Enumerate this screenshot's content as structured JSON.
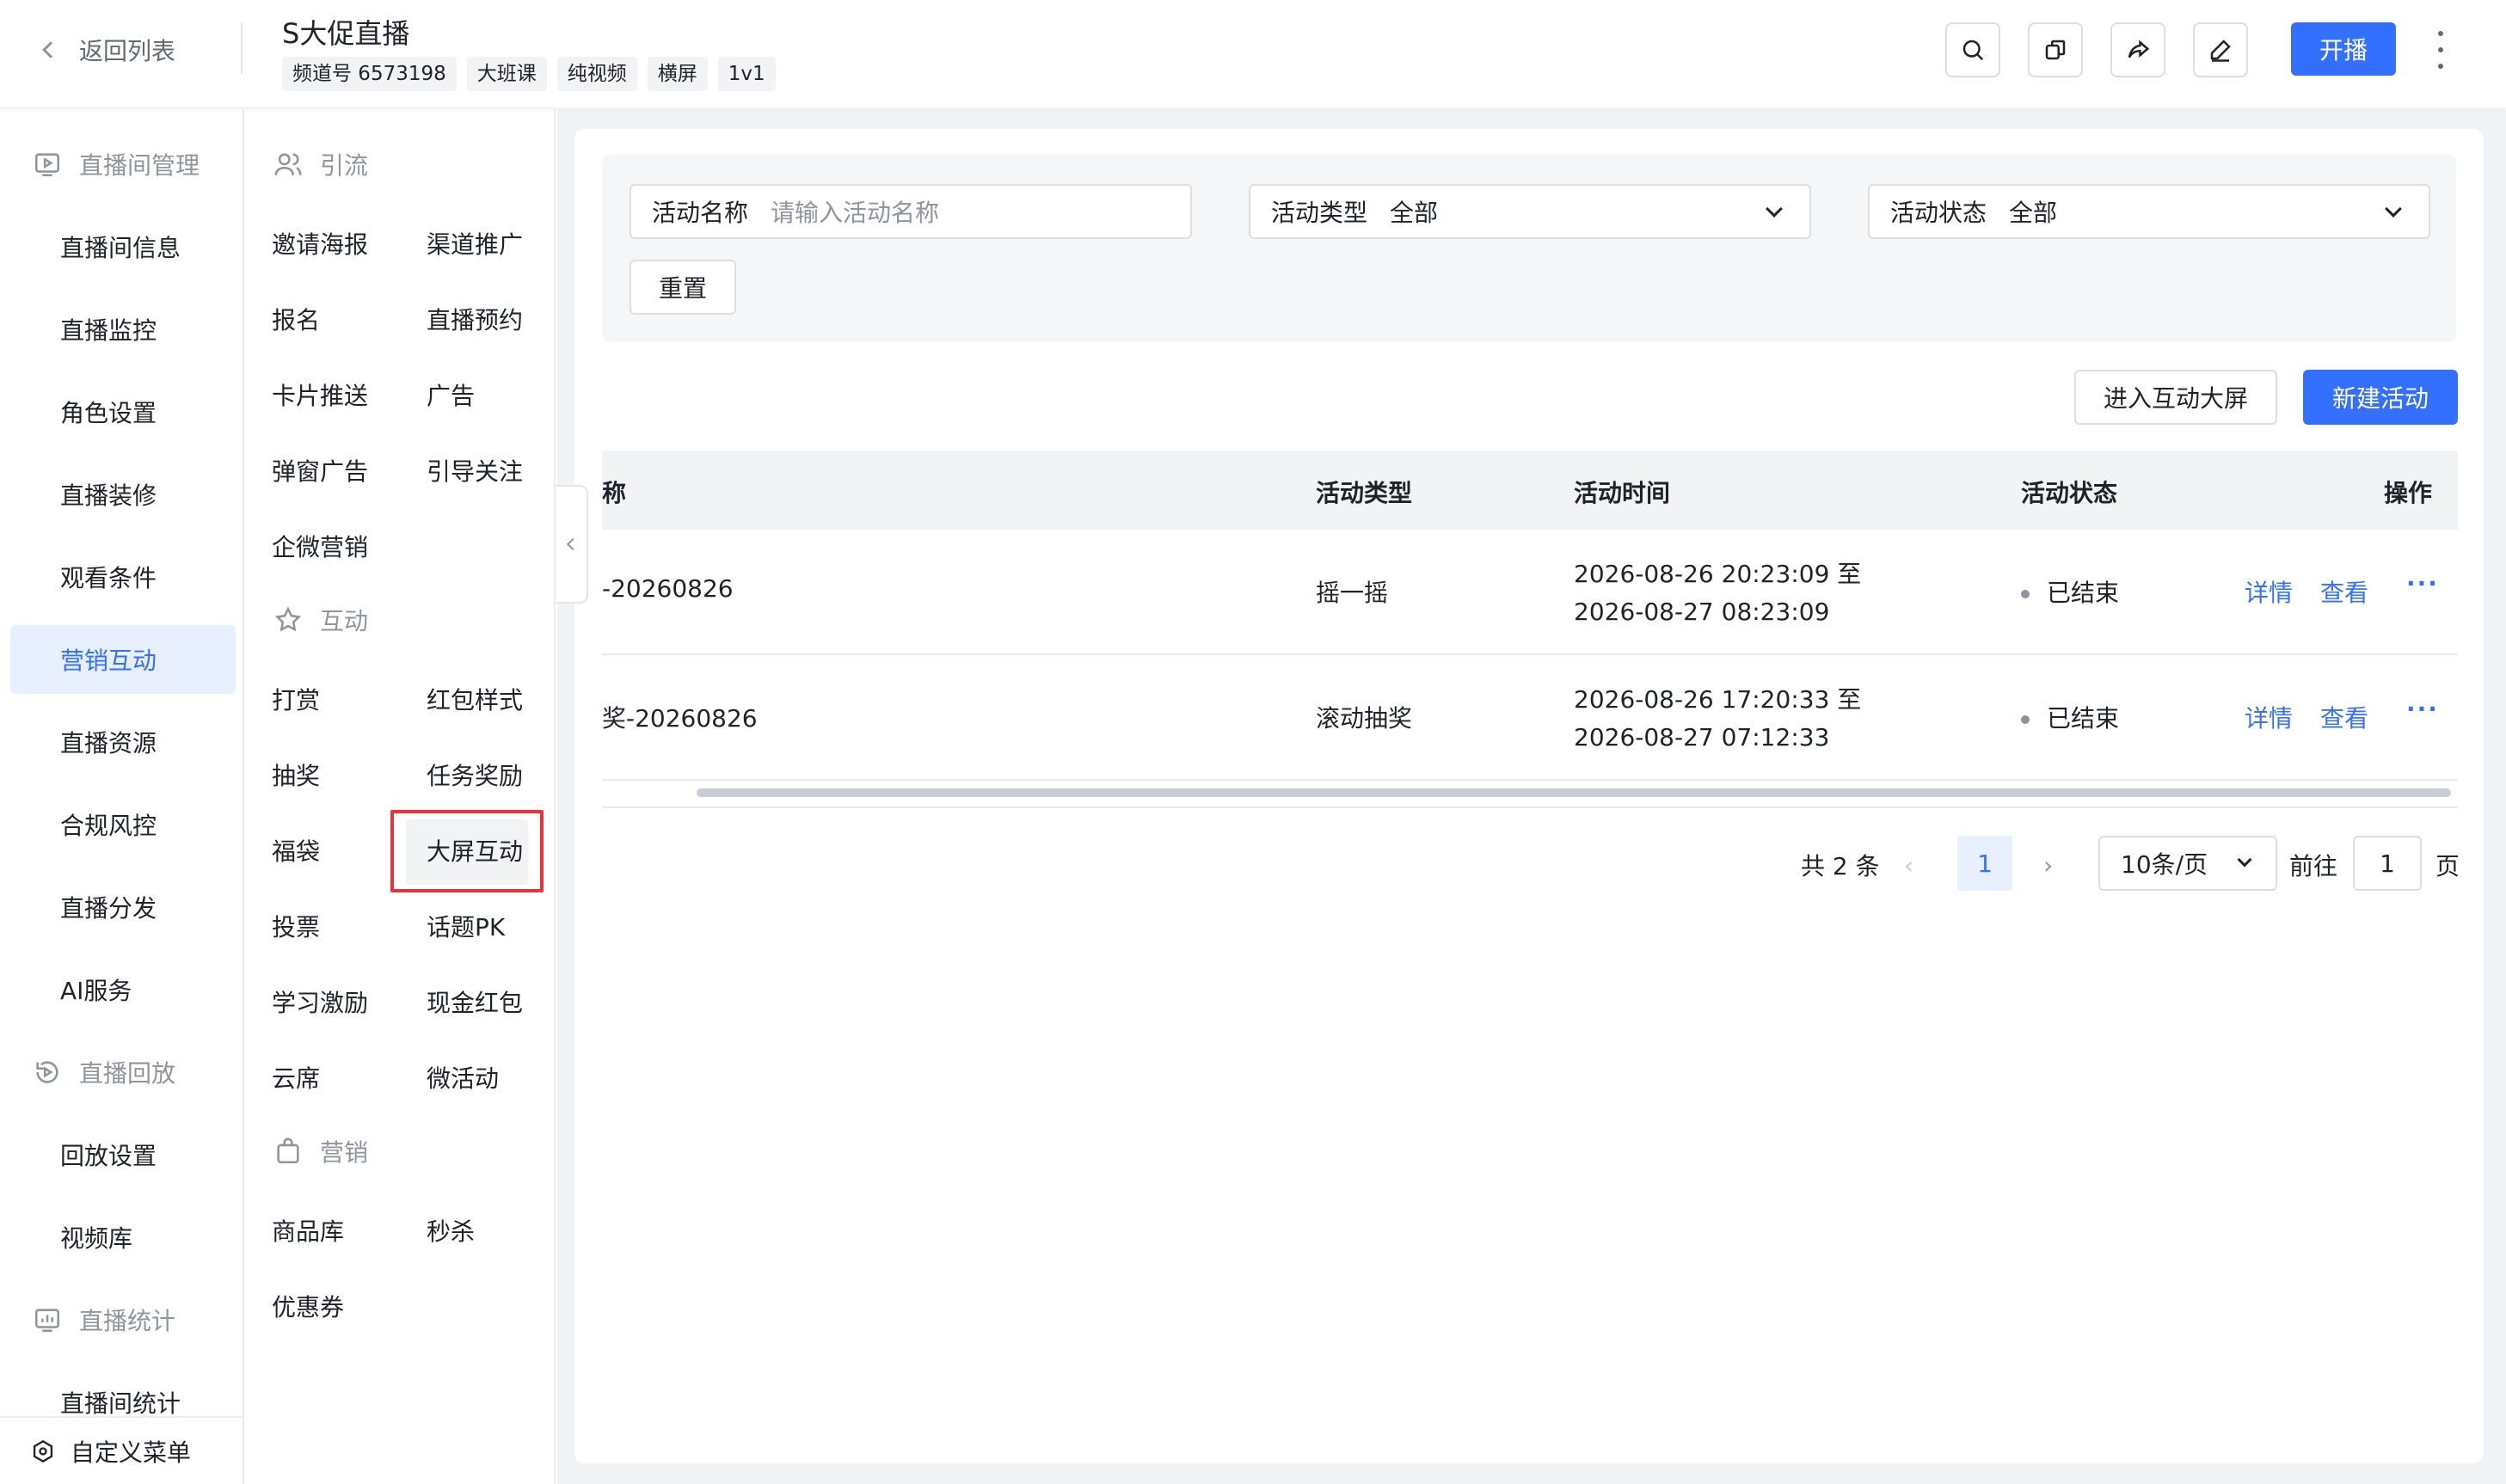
{
  "header": {
    "back_label": "返回列表",
    "title": "S大促直播",
    "tags": [
      "频道号 6573198",
      "大班课",
      "纯视频",
      "横屏",
      "1v1"
    ],
    "start_label": "开播"
  },
  "sidebar": {
    "groups": [
      {
        "label": "直播间管理",
        "icon": "monitor-play-icon"
      },
      {
        "label": "直播回放",
        "icon": "replay-icon"
      },
      {
        "label": "直播统计",
        "icon": "chart-icon"
      }
    ],
    "items": [
      "直播间信息",
      "直播监控",
      "角色设置",
      "直播装修",
      "观看条件",
      "营销互动",
      "直播资源",
      "合规风控",
      "直播分发",
      "AI服务",
      "回放设置",
      "视频库",
      "直播间统计"
    ],
    "active_item": "营销互动",
    "custom_menu_label": "自定义菜单"
  },
  "function_menu": {
    "groups": [
      {
        "label": "引流",
        "icon": "users-icon"
      },
      {
        "label": "互动",
        "icon": "star-icon"
      },
      {
        "label": "营销",
        "icon": "bag-icon"
      }
    ],
    "yinliu": [
      "邀请海报",
      "渠道推广",
      "报名",
      "直播预约",
      "卡片推送",
      "广告",
      "弹窗广告",
      "引导关注",
      "企微营销"
    ],
    "hudong": [
      "打赏",
      "红包样式",
      "抽奖",
      "任务奖励",
      "福袋",
      "大屏互动",
      "投票",
      "话题PK",
      "学习激励",
      "现金红包",
      "云席",
      "微活动"
    ],
    "yingxiao": [
      "商品库",
      "秒杀",
      "优惠券"
    ],
    "selected": "大屏互动"
  },
  "filters": {
    "name_label": "活动名称",
    "name_placeholder": "请输入活动名称",
    "type_label": "活动类型",
    "type_value": "全部",
    "status_label": "活动状态",
    "status_value": "全部",
    "reset_label": "重置"
  },
  "actions": {
    "enter_screen_label": "进入互动大屏",
    "new_activity_label": "新建活动"
  },
  "table": {
    "columns": [
      "称",
      "活动类型",
      "活动时间",
      "活动状态",
      "操作"
    ],
    "rows": [
      {
        "name": "-20260826",
        "type": "摇一摇",
        "time_start": "2026-08-26 20:23:09 至",
        "time_end": "2026-08-27 08:23:09",
        "status": "已结束",
        "action_detail": "详情",
        "action_view": "查看",
        "action_more": "···"
      },
      {
        "name": "奖-20260826",
        "type": "滚动抽奖",
        "time_start": "2026-08-26 17:20:33 至",
        "time_end": "2026-08-27 07:12:33",
        "status": "已结束",
        "action_detail": "详情",
        "action_view": "查看",
        "action_more": "···"
      }
    ]
  },
  "pagination": {
    "total_text": "共 2 条",
    "prev": "‹",
    "current_page": "1",
    "next": "›",
    "page_size": "10条/页",
    "goto_label": "前往",
    "goto_value": "1",
    "page_suffix": "页"
  },
  "colors": {
    "primary": "#3370ff",
    "highlight_box": "#e8323c",
    "active_bg": "#e8efff"
  }
}
